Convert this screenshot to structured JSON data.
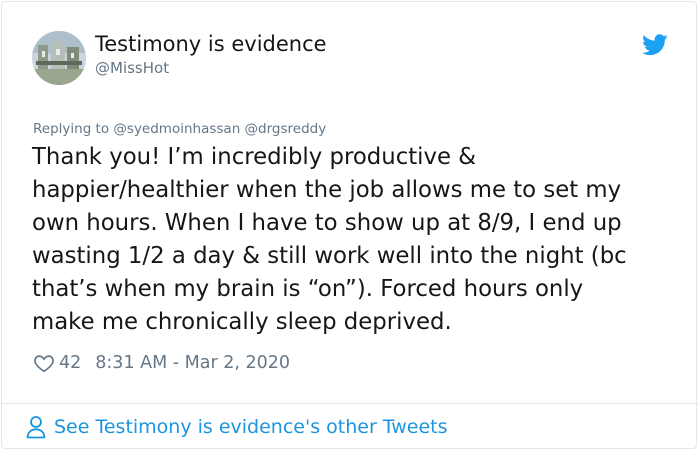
{
  "user": {
    "display_name": "Testimony is evidence",
    "handle": "@MissHot"
  },
  "reply": {
    "prefix": "Replying to",
    "mentions": "@syedmoinhassan @drgsreddy"
  },
  "tweet": {
    "text": "Thank you! I’m incredibly productive &\nhappier/healthier when the job allows me to set my\nown hours. When I have to show up at 8/9, I end up\nwasting 1/2 a day & still work well into the night (bc\nthat’s when my brain is “on”). Forced hours only\nmake me chronically sleep deprived.",
    "likes": "42",
    "timestamp": "8:31 AM - Mar 2, 2020"
  },
  "footer": {
    "link_label": "See Testimony is evidence's other Tweets"
  },
  "icons": {
    "brand": "twitter-bird-icon",
    "like": "heart-icon",
    "profile": "person-icon"
  },
  "colors": {
    "brand_blue": "#1da1f2",
    "link_blue": "#1b95e0",
    "muted_gray": "#657786",
    "text": "#14171a",
    "border": "#e1e8ed"
  }
}
